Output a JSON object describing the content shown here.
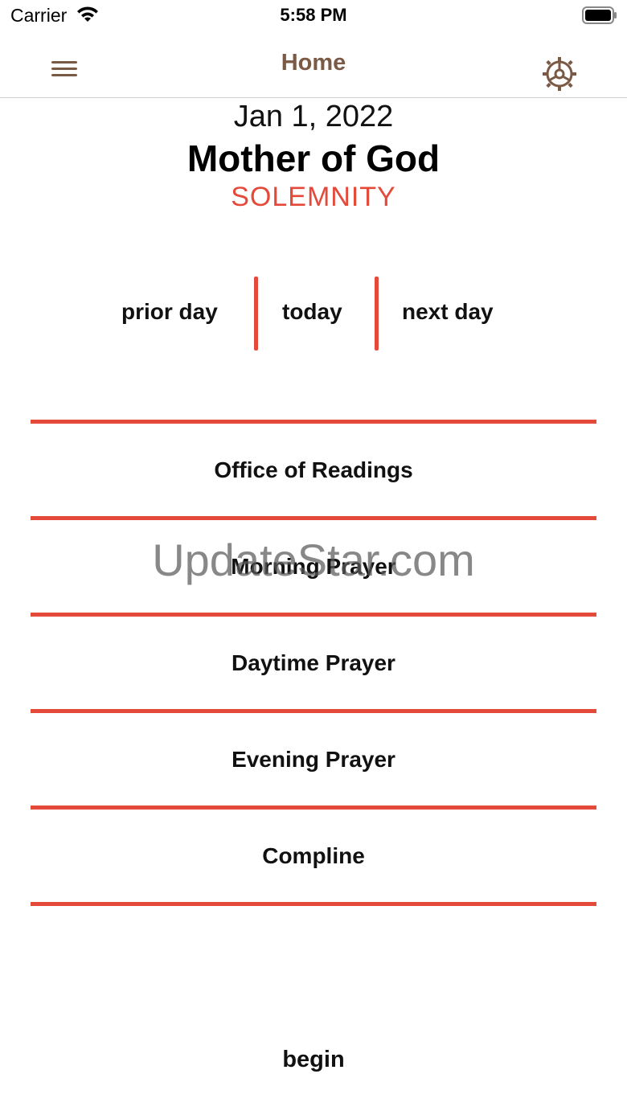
{
  "status_bar": {
    "carrier": "Carrier",
    "time": "5:58 PM",
    "wifi_icon": "wifi-icon",
    "battery_icon": "battery-icon"
  },
  "nav": {
    "title": "Home",
    "menu_icon": "hamburger-menu-icon",
    "settings_icon": "gear-icon",
    "accent_color": "#7b5a45"
  },
  "header": {
    "date": "Jan 1, 2022",
    "feast": "Mother of God",
    "rank": "SOLEMNITY",
    "rank_color": "#e5493a"
  },
  "day_nav": {
    "prior": "prior day",
    "today": "today",
    "next": "next day"
  },
  "hours": [
    {
      "label": "Office of Readings"
    },
    {
      "label": "Morning Prayer"
    },
    {
      "label": "Daytime Prayer"
    },
    {
      "label": "Evening Prayer"
    },
    {
      "label": "Compline"
    }
  ],
  "rule_color": "#e5493a",
  "watermark": "UpdateStar.com",
  "begin": "begin"
}
